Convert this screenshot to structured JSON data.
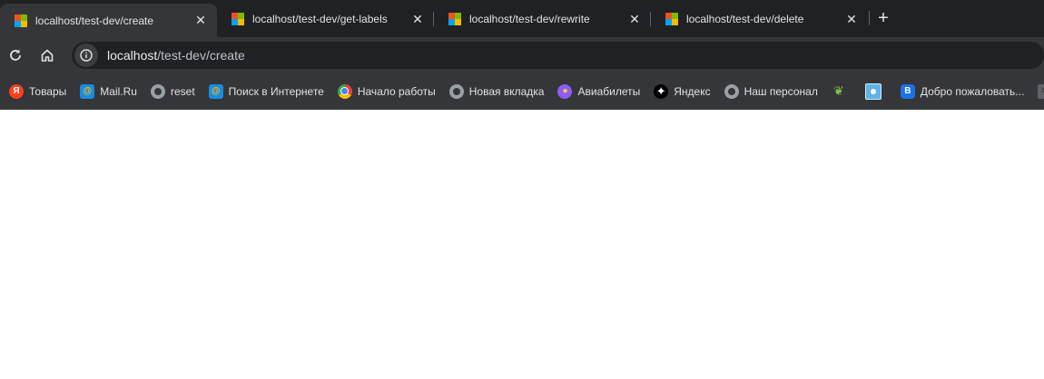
{
  "tabs": [
    {
      "title": "localhost/test-dev/create",
      "active": true
    },
    {
      "title": "localhost/test-dev/get-labels",
      "active": false
    },
    {
      "title": "localhost/test-dev/rewrite",
      "active": false
    },
    {
      "title": "localhost/test-dev/delete",
      "active": false
    }
  ],
  "tab_close_glyph": "✕",
  "new_tab_glyph": "+",
  "address": {
    "host": "localhost",
    "path": "/test-dev/create"
  },
  "bookmarks": [
    {
      "label": "Товары",
      "icon": "yandex-y-icon"
    },
    {
      "label": "Mail.Ru",
      "icon": "mailru-at-icon"
    },
    {
      "label": "reset",
      "icon": "globe-icon"
    },
    {
      "label": "Поиск в Интернете",
      "icon": "mailru-at-icon"
    },
    {
      "label": "Начало работы",
      "icon": "chrome-icon"
    },
    {
      "label": "Новая вкладка",
      "icon": "globe-icon"
    },
    {
      "label": "Авиабилеты",
      "icon": "planet-icon"
    },
    {
      "label": "Яндекс",
      "icon": "star-icon"
    },
    {
      "label": "Наш персонал",
      "icon": "globe-icon"
    },
    {
      "label": "",
      "icon": "leaf-icon"
    },
    {
      "label": "",
      "icon": "square-app-icon"
    },
    {
      "label": "Добро пожаловать...",
      "icon": "blue-b-icon"
    },
    {
      "label": "",
      "icon": "mail-icon"
    }
  ],
  "colors": {
    "tab_strip": "#202124",
    "toolbar": "#35363a",
    "favicon": [
      "#f25022",
      "#7fba00",
      "#00a4ef",
      "#ffb900"
    ]
  }
}
